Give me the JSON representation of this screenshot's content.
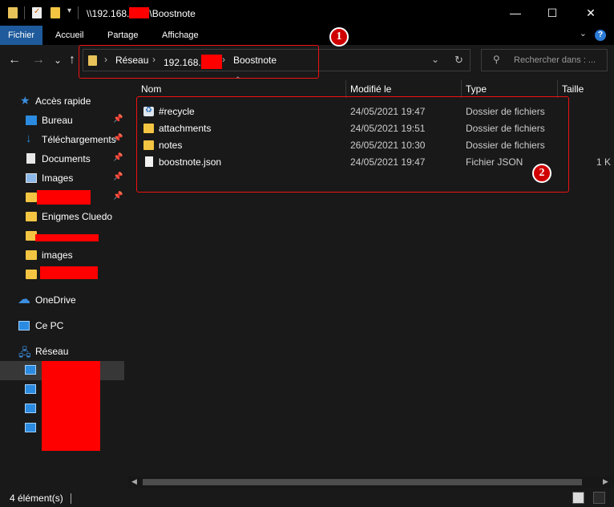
{
  "titlebar": {
    "path_prefix": "\\\\192.168.",
    "path_suffix": "\\Boostnote",
    "minimize": "—",
    "maximize": "☐",
    "close": "✕"
  },
  "ribbon": {
    "tabs": [
      "Fichier",
      "Accueil",
      "Partage",
      "Affichage"
    ],
    "help": "?"
  },
  "navbar": {
    "back": "←",
    "forward": "→",
    "recent": "⌄",
    "up": "↑",
    "breadcrumb": [
      "Réseau",
      "192.168.",
      "Boostnote"
    ],
    "search_placeholder": "Rechercher dans : ..."
  },
  "annotations": {
    "badge1": "1",
    "badge2": "2"
  },
  "sidebar": {
    "quick_access": "Accès rapide",
    "items": [
      {
        "label": "Bureau",
        "pinned": true,
        "icon": "desktop-icon"
      },
      {
        "label": "Téléchargements",
        "pinned": true,
        "icon": "download-icon"
      },
      {
        "label": "Documents",
        "pinned": true,
        "icon": "document-icon"
      },
      {
        "label": "Images",
        "pinned": true,
        "icon": "image-icon"
      },
      {
        "label": "",
        "pinned": true,
        "icon": "folder-icon"
      },
      {
        "label": "Enigmes Cluedo",
        "pinned": false,
        "icon": "folder-icon"
      },
      {
        "label": "",
        "pinned": false,
        "icon": "folder-icon"
      },
      {
        "label": "images",
        "pinned": false,
        "icon": "folder-icon"
      },
      {
        "label": "",
        "pinned": false,
        "icon": "folder-icon"
      }
    ],
    "onedrive": "OneDrive",
    "thispc": "Ce PC",
    "network": "Réseau"
  },
  "columns": {
    "name": "Nom",
    "modified": "Modifié le",
    "type": "Type",
    "size": "Taille"
  },
  "files": [
    {
      "name": "#recycle",
      "modified": "24/05/2021 19:47",
      "type": "Dossier de fichiers",
      "size": "",
      "icon": "recycle-bin-icon"
    },
    {
      "name": "attachments",
      "modified": "24/05/2021 19:51",
      "type": "Dossier de fichiers",
      "size": "",
      "icon": "folder-icon"
    },
    {
      "name": "notes",
      "modified": "26/05/2021 10:30",
      "type": "Dossier de fichiers",
      "size": "",
      "icon": "folder-icon"
    },
    {
      "name": "boostnote.json",
      "modified": "24/05/2021 19:47",
      "type": "Fichier JSON",
      "size": "1 K",
      "icon": "file-icon"
    }
  ],
  "status": {
    "count": "4 élément(s)"
  },
  "colors": {
    "accent": "#1f5b9c",
    "folder": "#f4c542",
    "redaction": "#ff0000",
    "annotation": "#e11111"
  }
}
